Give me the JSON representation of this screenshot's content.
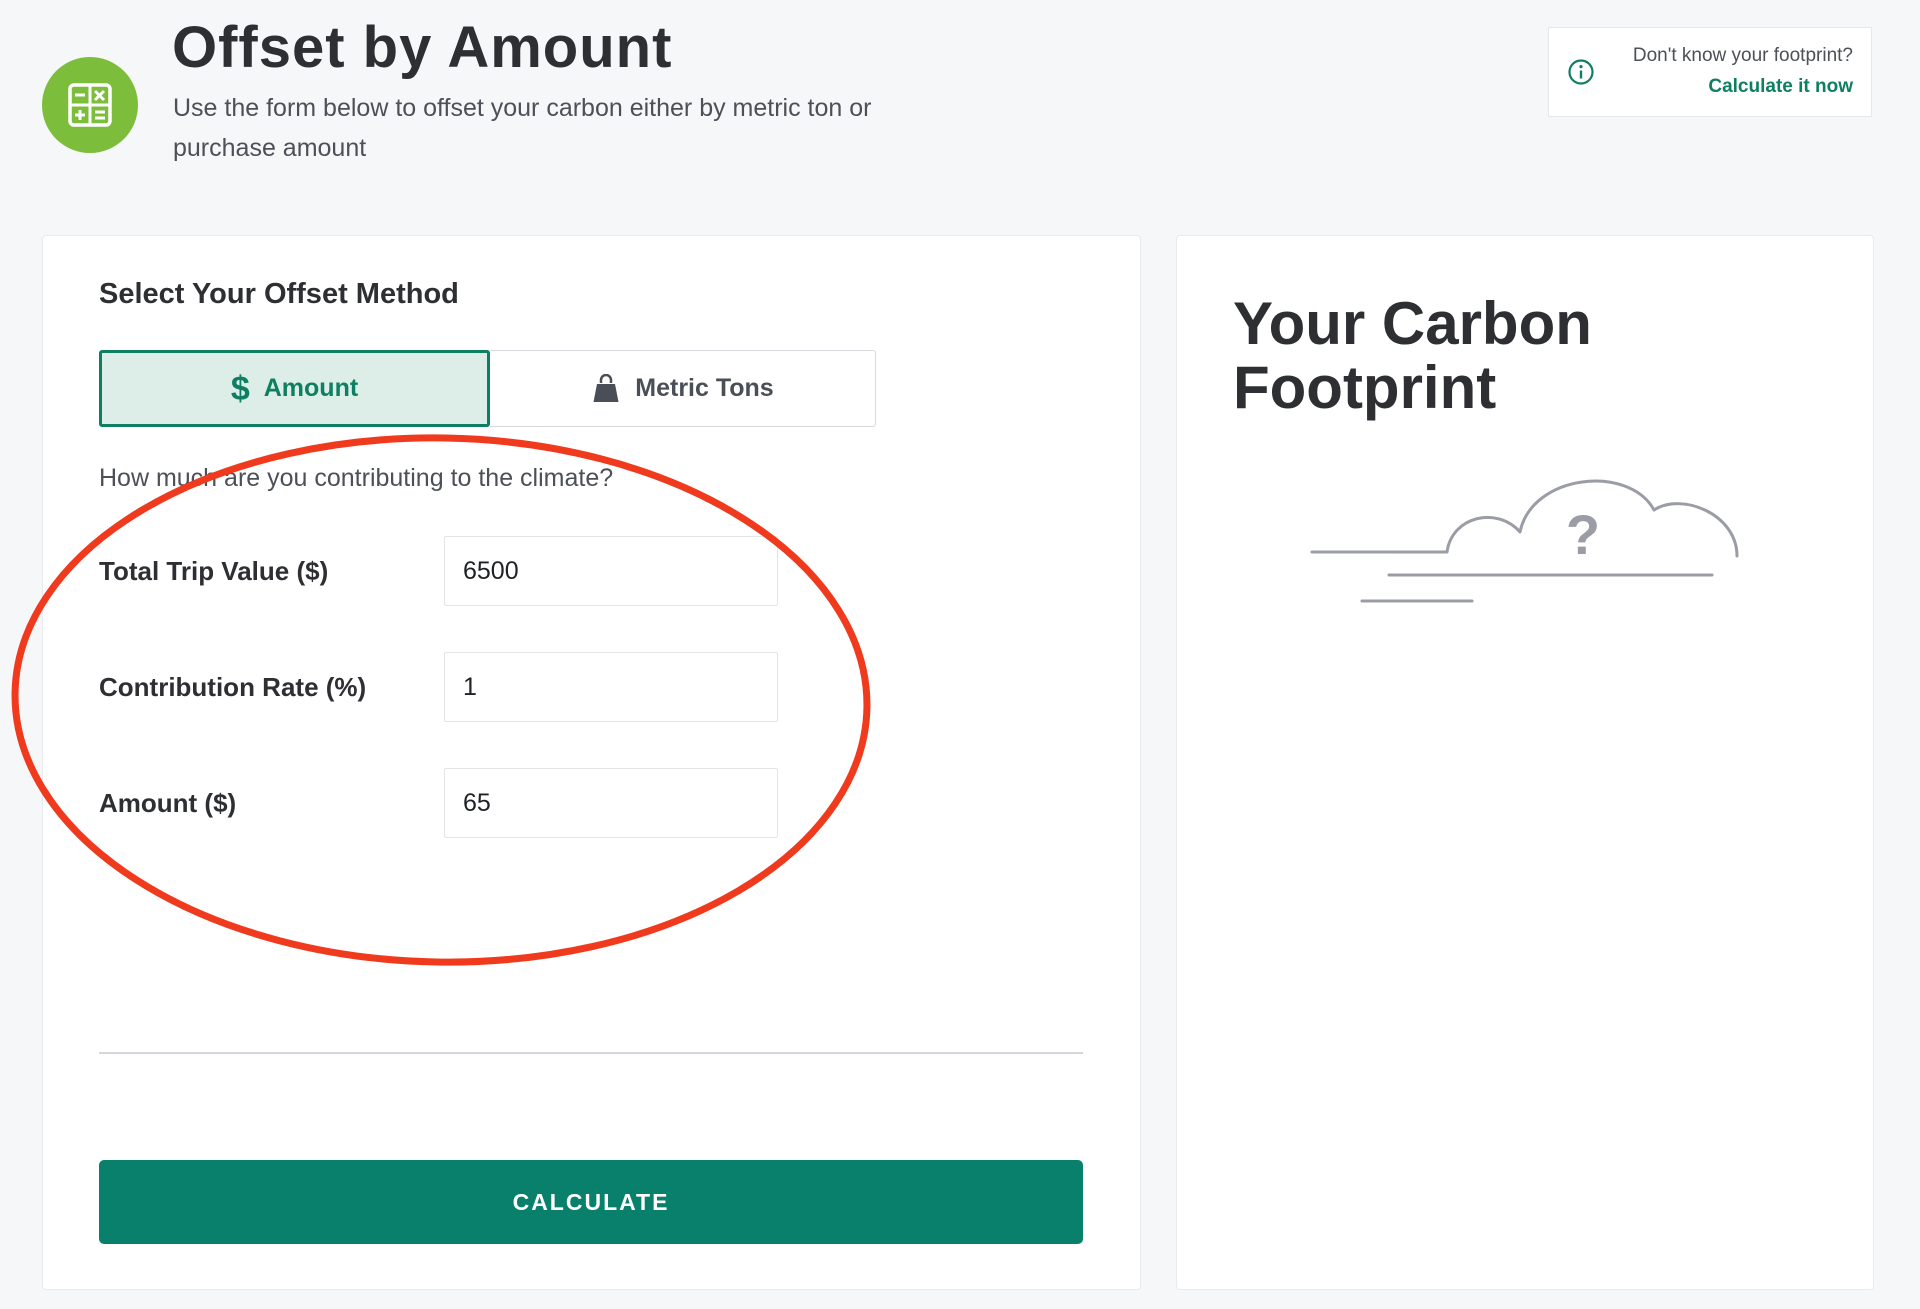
{
  "header": {
    "title": "Offset by Amount",
    "subtitle": "Use the form below to offset your carbon either by metric ton or purchase amount",
    "icon": "calculator-icon",
    "badge_color": "#7cbd3b"
  },
  "help": {
    "question": "Don't know your footprint?",
    "link": "Calculate it now",
    "icon": "info-icon"
  },
  "form": {
    "heading": "Select Your Offset Method",
    "methods": [
      {
        "label": "Amount",
        "icon": "dollar-icon",
        "active": true
      },
      {
        "label": "Metric Tons",
        "icon": "weight-icon",
        "active": false
      }
    ],
    "prompt": "How much are you contributing to the climate?",
    "fields": [
      {
        "label": "Total Trip Value ($)",
        "value": "6500"
      },
      {
        "label": "Contribution Rate (%)",
        "value": "1"
      },
      {
        "label": "Amount ($)",
        "value": "65"
      }
    ],
    "submit": "CALCULATE"
  },
  "footprint": {
    "title": "Your Carbon Footprint",
    "cloud_symbol": "?"
  },
  "colors": {
    "accent": "#0e7f62",
    "button": "#08806b",
    "annotation": "#f03a1e"
  }
}
